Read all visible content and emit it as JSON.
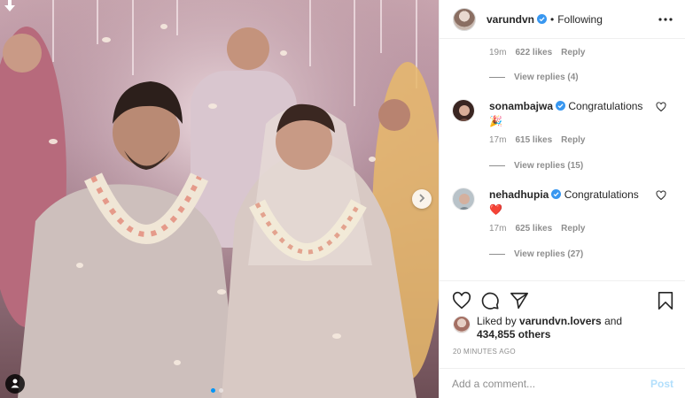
{
  "header": {
    "username": "varundvn",
    "bullet": "•",
    "follow_state": "Following"
  },
  "comments": {
    "top": {
      "time": "19m",
      "likes": "622 likes",
      "reply": "Reply",
      "view_replies": "View replies (4)"
    },
    "items": [
      {
        "username": "sonambajwa",
        "text": "Congratulations",
        "emoji": "🎉",
        "time": "17m",
        "likes": "615 likes",
        "reply": "Reply",
        "view_replies": "View replies (15)"
      },
      {
        "username": "nehadhupia",
        "text": "Congratulations",
        "emoji": "❤️",
        "time": "17m",
        "likes": "625 likes",
        "reply": "Reply",
        "view_replies": "View replies (27)"
      }
    ]
  },
  "likes": {
    "prefix": "Liked by ",
    "user": "varundvn.lovers",
    "and": " and",
    "count": "434,855 others"
  },
  "timestamp": "20 MINUTES AGO",
  "add_comment": {
    "placeholder": "Add a comment...",
    "post_label": "Post"
  },
  "colors": {
    "verified": "#3897f0",
    "heart_emoji": "#e0245e",
    "post_disabled": "#b2dffc",
    "carousel_active_dot": "#0095f6"
  },
  "icons": [
    "heart-icon",
    "comment-icon",
    "share-icon",
    "bookmark-icon",
    "more-options-icon",
    "verified-icon",
    "chevron-right-icon",
    "user-tag-icon",
    "back-arrow-icon"
  ],
  "carousel": {
    "slides": 2,
    "active": 1
  }
}
